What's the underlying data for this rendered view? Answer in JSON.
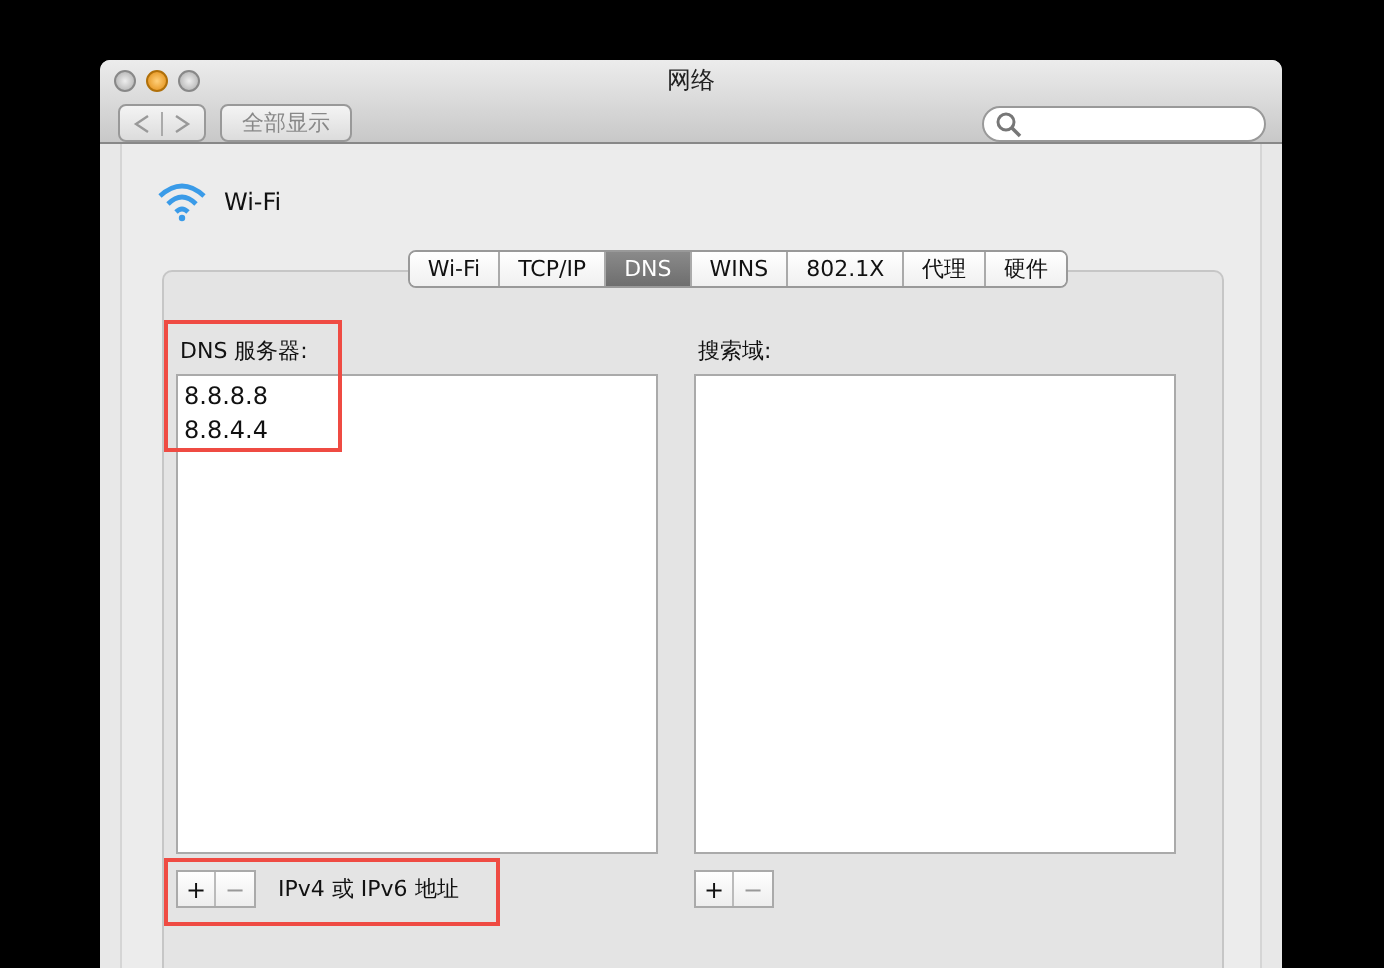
{
  "window": {
    "title": "网络"
  },
  "toolbar": {
    "show_all_button": "全部显示"
  },
  "service": {
    "name": "Wi-Fi"
  },
  "tabs": [
    {
      "label": "Wi-Fi",
      "selected": false
    },
    {
      "label": "TCP/IP",
      "selected": false
    },
    {
      "label": "DNS",
      "selected": true
    },
    {
      "label": "WINS",
      "selected": false
    },
    {
      "label": "802.1X",
      "selected": false
    },
    {
      "label": "代理",
      "selected": false
    },
    {
      "label": "硬件",
      "selected": false
    }
  ],
  "dns_servers": {
    "label": "DNS 服务器:",
    "entries": [
      "8.8.8.8",
      "8.8.4.4"
    ],
    "buttons": [
      {
        "label": "+",
        "disabled": false
      },
      {
        "label": "−",
        "disabled": true
      }
    ],
    "hint": "IPv4 或 IPv6 地址"
  },
  "search_domains": {
    "label": "搜索域:",
    "buttons": [
      {
        "label": "+",
        "disabled": false
      },
      {
        "label": "−",
        "disabled": true
      }
    ]
  }
}
